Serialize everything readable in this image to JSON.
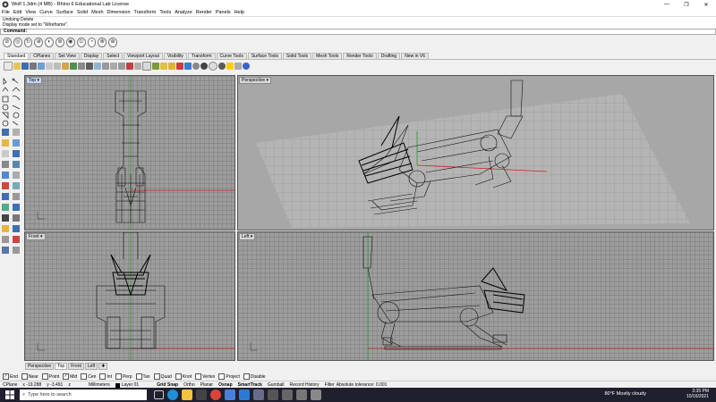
{
  "window": {
    "title": "Wolf 1.3dm (4 MB) - Rhino 6 Educational Lab License",
    "controls": [
      "—",
      "❐",
      "✕"
    ]
  },
  "menu": [
    "File",
    "Edit",
    "View",
    "Curve",
    "Surface",
    "Solid",
    "Mesh",
    "Dimension",
    "Transform",
    "Tools",
    "Analyze",
    "Render",
    "Panels",
    "Help"
  ],
  "command": {
    "history": [
      "Undoing Delete",
      "Display mode set to \"Wireframe\"."
    ],
    "prompt": "Command:"
  },
  "tabs": [
    "Standard",
    "CPlanes",
    "Set View",
    "Display",
    "Select",
    "Viewport Layout",
    "Visibility",
    "Transform",
    "Curve Tools",
    "Surface Tools",
    "Solid Tools",
    "Mesh Tools",
    "Render Tools",
    "Drafting",
    "New in V6"
  ],
  "active_tab": "Standard",
  "viewports": {
    "top": "Top",
    "perspective": "Perspective",
    "front": "Front",
    "left": "Left"
  },
  "viewport_tabs": [
    "Perspective",
    "Top",
    "Front",
    "Left"
  ],
  "osnaps": [
    {
      "label": "End",
      "checked": true
    },
    {
      "label": "Near",
      "checked": false
    },
    {
      "label": "Point",
      "checked": false
    },
    {
      "label": "Mid",
      "checked": true
    },
    {
      "label": "Cen",
      "checked": false
    },
    {
      "label": "Int",
      "checked": false
    },
    {
      "label": "Perp",
      "checked": false
    },
    {
      "label": "Tan",
      "checked": false
    },
    {
      "label": "Quad",
      "checked": false
    },
    {
      "label": "Knot",
      "checked": false
    },
    {
      "label": "Vertex",
      "checked": false
    },
    {
      "label": "Project",
      "checked": false
    },
    {
      "label": "Disable",
      "checked": false
    }
  ],
  "status": {
    "cplane": "CPlane",
    "x": "x -19.288",
    "y": "y -3.491",
    "z": "z",
    "units": "Millimeters",
    "layer": "Layer 01",
    "toggles": [
      "Grid Snap",
      "Ortho",
      "Planar",
      "Osnap",
      "SmartTrack",
      "Gumball",
      "Record History",
      "Filter"
    ],
    "tolerance": "Absolute tolerance: 0.001"
  },
  "taskbar": {
    "search_placeholder": "Type here to search",
    "weather": "80°F  Mostly cloudy",
    "time": "3:35 PM",
    "date": "10/16/2021"
  }
}
